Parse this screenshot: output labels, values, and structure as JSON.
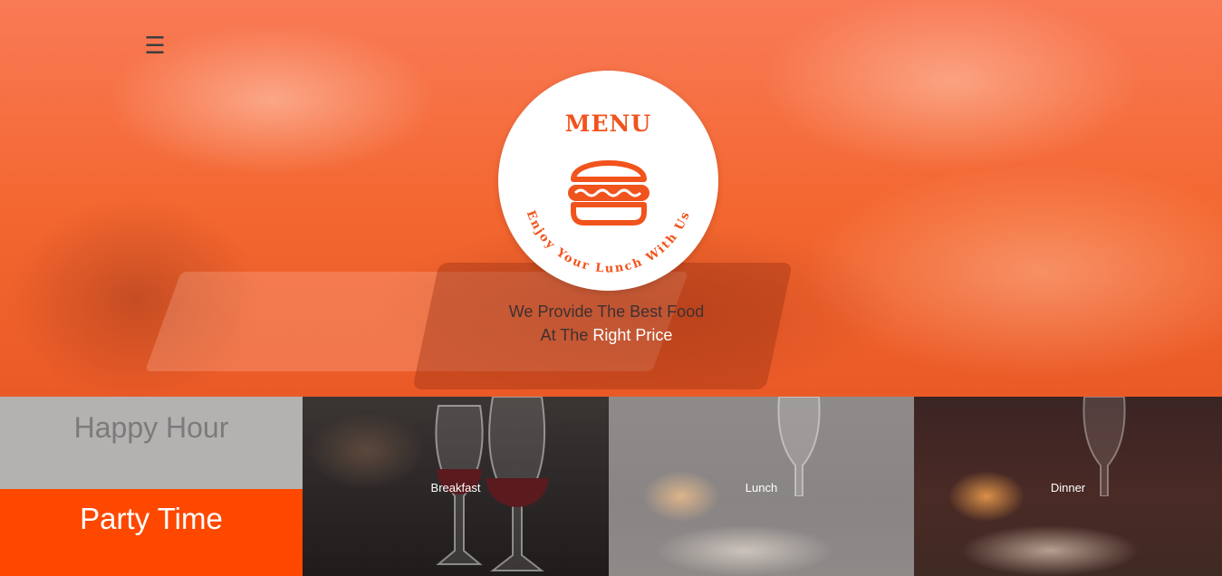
{
  "nav": {
    "hamburger_icon": "☰"
  },
  "logo": {
    "title": "MENU",
    "arc_text": "Enjoy Your Lunch With Us",
    "icon": "burger-icon",
    "color": "#f1531c"
  },
  "tagline": {
    "line1": "We Provide The Best Food",
    "line2_prefix": "At The ",
    "line2_highlight": "Right Price"
  },
  "promo": {
    "happy_hour": "Happy Hour",
    "party_time": "Party Time",
    "party_color": "#fe4800"
  },
  "tiles": [
    {
      "label": "Breakfast"
    },
    {
      "label": "Lunch"
    },
    {
      "label": "Dinner"
    }
  ]
}
